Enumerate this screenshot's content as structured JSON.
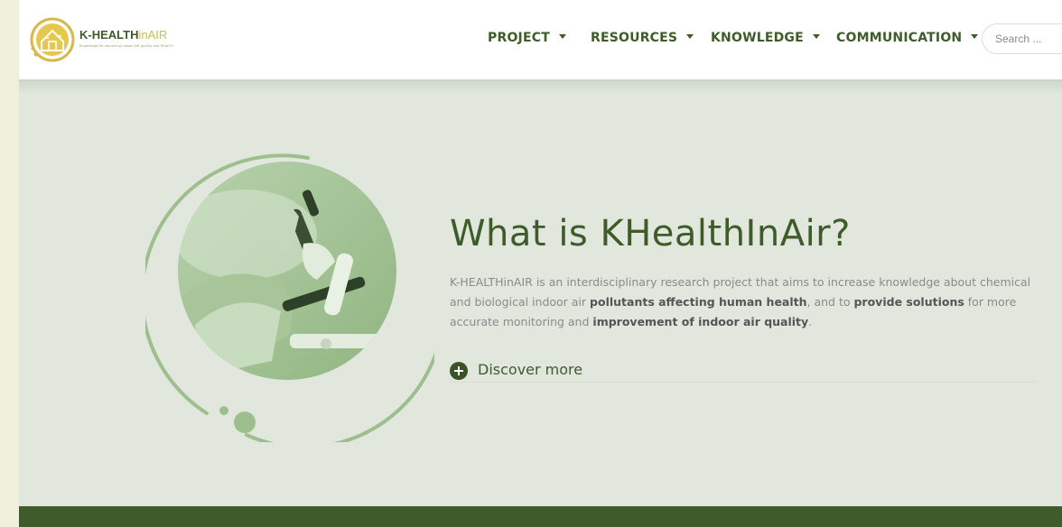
{
  "brand": {
    "name_main": "K-HEALTH",
    "name_accent": "inAIR",
    "tagline": "Knowledge for improving indoor AIR quality and HEALTH"
  },
  "nav": {
    "items": [
      {
        "label": "PROJECT"
      },
      {
        "label": "RESOURCES"
      },
      {
        "label": "KNOWLEDGE"
      },
      {
        "label": "COMMUNICATION"
      }
    ]
  },
  "search": {
    "placeholder": "Search ..."
  },
  "hero": {
    "title": "What is KHealthInAir?",
    "description_parts": {
      "p1": "K-HEALTHinAIR is an interdisciplinary research project that aims to increase knowledge about chemical and biological indoor air ",
      "b1": "pollutants affecting human health",
      "p2": ", and to ",
      "b2": "provide solutions",
      "p3": " for more accurate monitoring and ",
      "b3": "improvement of indoor air quality",
      "p4": "."
    },
    "cta": "Discover more"
  },
  "colors": {
    "primary": "#3e5c2a",
    "accent": "#c8c04a",
    "background": "#e2e7de",
    "ring": "#9dbf8e"
  },
  "icons": {
    "logo": "house-circle-logo-icon",
    "cta": "plus-circle-icon",
    "caret": "caret-down-icon"
  }
}
